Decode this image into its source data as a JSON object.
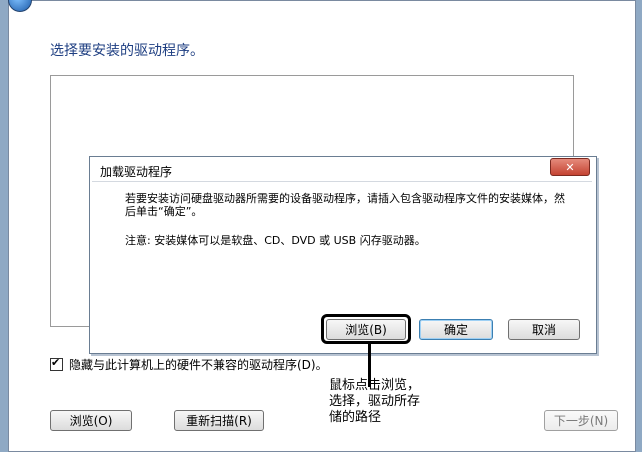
{
  "wizard": {
    "title": "选择要安装的驱动程序。",
    "hide_incompatible_label": "隐藏与此计算机上的硬件不兼容的驱动程序(D)。",
    "browse_label": "浏览(O)",
    "rescan_label": "重新扫描(R)",
    "next_label": "下一步(N)"
  },
  "dialog": {
    "title": "加载驱动程序",
    "close_label": "✕",
    "message": "若要安装访问硬盘驱动器所需要的设备驱动程序，请插入包含驱动程序文件的安装媒体，然后单击“确定”。",
    "note": "注意: 安装媒体可以是软盘、CD、DVD 或 USB 闪存驱动器。",
    "browse_label": "浏览(B)",
    "ok_label": "确定",
    "cancel_label": "取消"
  },
  "annotation": {
    "text": "鼠标点击浏览，\n选择，驱动所存\n储的路径"
  }
}
